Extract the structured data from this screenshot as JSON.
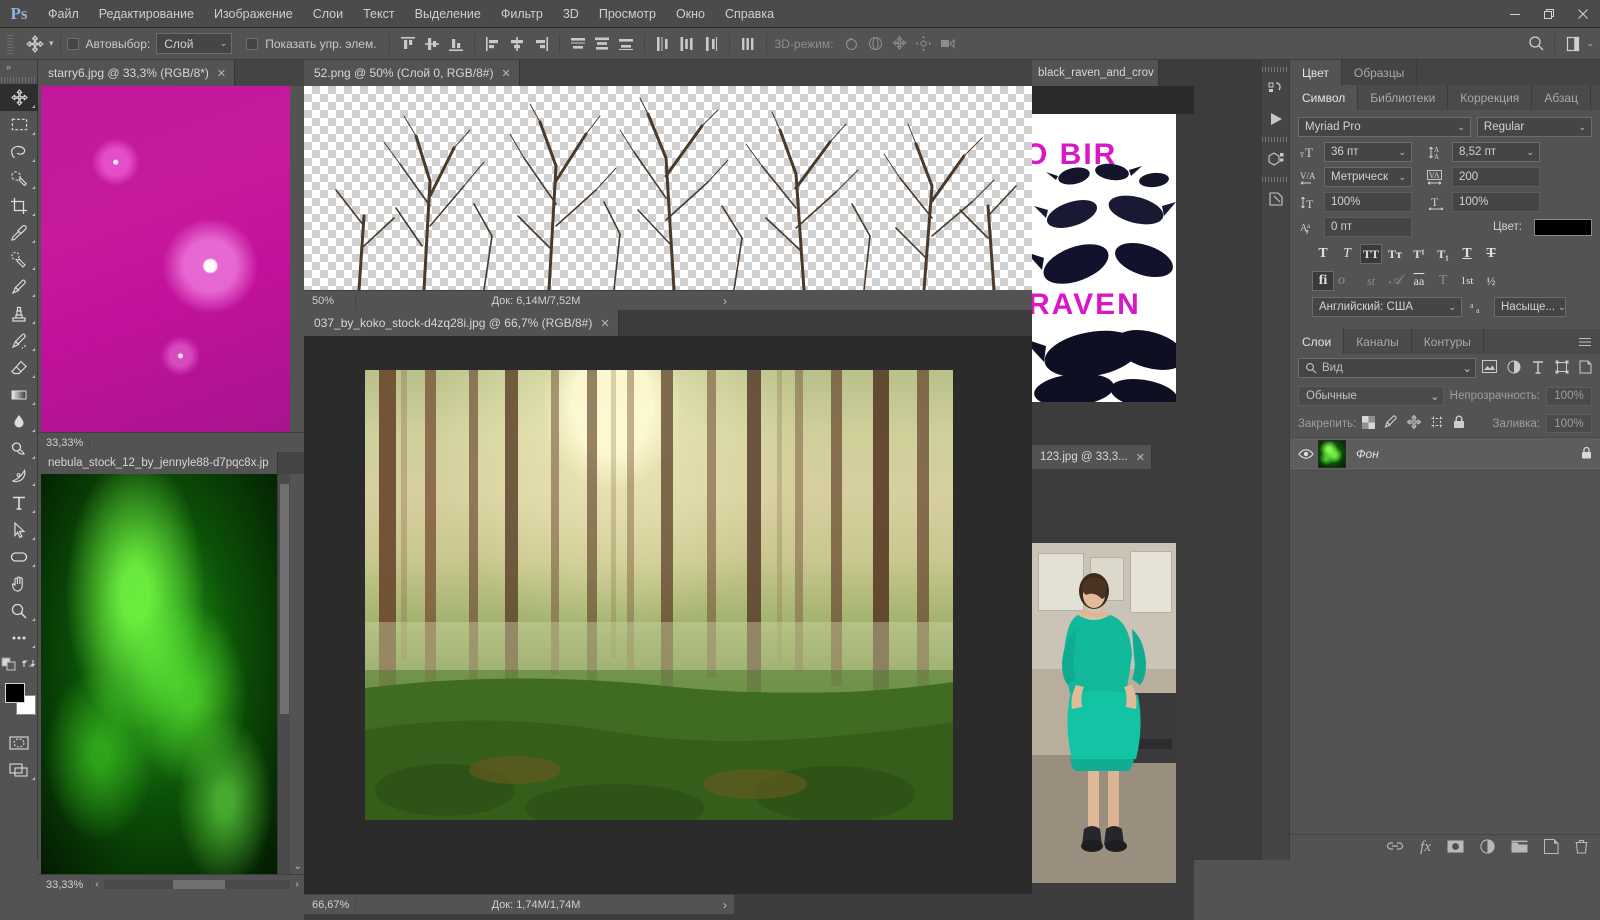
{
  "app": {
    "logo": "Ps"
  },
  "menubar": {
    "items": [
      "Файл",
      "Редактирование",
      "Изображение",
      "Слои",
      "Текст",
      "Выделение",
      "Фильтр",
      "3D",
      "Просмотр",
      "Окно",
      "Справка"
    ],
    "window_controls": [
      "minimize",
      "restore",
      "close"
    ]
  },
  "options_bar": {
    "tool": "move-tool",
    "autoselect_label": "Автовыбор:",
    "autoselect_checked": false,
    "autoselect_value": "Слой",
    "show_controls_label": "Показать упр. элем.",
    "show_controls_checked": false,
    "align_icons": [
      "align-top-edges",
      "align-vertical-centers",
      "align-bottom-edges",
      "align-left-edges",
      "align-horizontal-centers",
      "align-right-edges"
    ],
    "distribute_icons": [
      "distribute-top-edges",
      "distribute-vertical-centers",
      "distribute-bottom-edges",
      "distribute-left-edges",
      "distribute-horizontal-centers",
      "distribute-right-edges",
      "distribute-spacing"
    ],
    "mode3d_label": "3D-режим:",
    "mode3d_icons": [
      "orbit-3d",
      "roll-3d",
      "pan-3d",
      "slide-3d",
      "zoom-camera-3d"
    ],
    "search_icon": "search-icon",
    "workspace_icon": "workspace-switcher"
  },
  "toolbar": {
    "collapse_icon": "double-chevron-right",
    "tools": [
      {
        "name": "move-tool",
        "active": true
      },
      {
        "name": "rectangular-marquee-tool",
        "active": false
      },
      {
        "name": "lasso-tool",
        "active": false
      },
      {
        "name": "quick-selection-tool",
        "active": false
      },
      {
        "name": "crop-tool",
        "active": false
      },
      {
        "name": "eyedropper-tool",
        "active": false
      },
      {
        "name": "spot-healing-brush-tool",
        "active": false
      },
      {
        "name": "brush-tool",
        "active": false
      },
      {
        "name": "clone-stamp-tool",
        "active": false
      },
      {
        "name": "history-brush-tool",
        "active": false
      },
      {
        "name": "eraser-tool",
        "active": false
      },
      {
        "name": "gradient-tool",
        "active": false
      },
      {
        "name": "blur-tool",
        "active": false
      },
      {
        "name": "dodge-tool",
        "active": false
      },
      {
        "name": "pen-tool",
        "active": false
      },
      {
        "name": "horizontal-type-tool",
        "active": false
      },
      {
        "name": "path-selection-tool",
        "active": false
      },
      {
        "name": "rounded-rectangle-tool",
        "active": false
      },
      {
        "name": "hand-tool",
        "active": false
      },
      {
        "name": "zoom-tool",
        "active": false
      },
      {
        "name": "edit-toolbar-tool",
        "active": false
      }
    ],
    "default_colors_icon": "default-colors",
    "swap_colors_icon": "swap-colors",
    "foreground_color": "#000000",
    "background_color": "#ffffff",
    "quickmask_icon": "quick-mask-mode",
    "screenmode_icon": "screen-mode"
  },
  "documents": [
    {
      "id": "starry",
      "tab_title": "starry6.jpg @ 33,3% (RGB/8*)",
      "active": true,
      "zoom": "33,33%",
      "doc_info": "",
      "thumb_kind": "magenta-nebula"
    },
    {
      "id": "png52",
      "tab_title": "52.png @ 50% (Слой 0, RGB/8#)",
      "active": true,
      "zoom": "50%",
      "doc_info": "Док: 6,14M/7,52M",
      "thumb_kind": "trees-transparent"
    },
    {
      "id": "nebula",
      "tab_title": "nebula_stock_12_by_jennyle88-d7pqc8x.jp",
      "active": true,
      "zoom": "33,33%",
      "doc_info": "",
      "thumb_kind": "green-nebula"
    },
    {
      "id": "forest",
      "tab_title": "037_by_koko_stock-d4zq28i.jpg @ 66,7% (RGB/8#)",
      "active": true,
      "zoom": "66,67%",
      "doc_info": "Док: 1,74M/1,74M",
      "thumb_kind": "forest"
    },
    {
      "id": "raven",
      "tab_title": "black_raven_and_crov",
      "active": true,
      "zoom": "",
      "doc_info": "",
      "thumb_kind": "raven-poster"
    },
    {
      "id": "girl",
      "tab_title": "123.jpg @ 33,3...",
      "active": true,
      "zoom": "",
      "doc_info": "",
      "thumb_kind": "girl-photo"
    }
  ],
  "right_dock": {
    "rail_icons": [
      "history-icon",
      "play-icon",
      "3d-icon",
      "properties-icon"
    ],
    "color_group": {
      "tabs": [
        {
          "label": "Цвет",
          "active": true
        },
        {
          "label": "Образцы",
          "active": false
        }
      ]
    },
    "character_group": {
      "tabs": [
        {
          "label": "Символ",
          "active": true
        },
        {
          "label": "Библиотеки",
          "active": false
        },
        {
          "label": "Коррекция",
          "active": false
        },
        {
          "label": "Абзац",
          "active": false
        }
      ],
      "font_family": "Myriad Pro",
      "font_style": "Regular",
      "font_size_icon": "font-size-icon",
      "font_size": "36 пт",
      "leading_icon": "leading-icon",
      "leading": "8,52 пт",
      "kerning_icon": "kerning-icon",
      "kerning": "Метрическ",
      "tracking_icon": "tracking-icon",
      "tracking": "200",
      "vscale_icon": "vertical-scale-icon",
      "vertical_scale": "100%",
      "hscale_icon": "horizontal-scale-icon",
      "horizontal_scale": "100%",
      "baseline_icon": "baseline-shift-icon",
      "baseline_shift": "0 пт",
      "color_label": "Цвет:",
      "color_value": "#000000",
      "style_row1": [
        {
          "glyph": "T",
          "name": "faux-bold",
          "on": false,
          "dim": false
        },
        {
          "glyph": "T",
          "name": "faux-italic",
          "on": false,
          "dim": false
        },
        {
          "glyph": "TT",
          "name": "all-caps",
          "on": true,
          "dim": false
        },
        {
          "glyph": "Tт",
          "name": "small-caps",
          "on": false,
          "dim": false
        },
        {
          "glyph": "T¹",
          "name": "superscript",
          "on": false,
          "dim": false
        },
        {
          "glyph": "T₁",
          "name": "subscript",
          "on": false,
          "dim": false
        },
        {
          "glyph": "T",
          "name": "underline",
          "on": false,
          "dim": false
        },
        {
          "glyph": "T",
          "name": "strikethrough",
          "on": false,
          "dim": false
        }
      ],
      "style_row2": [
        {
          "glyph": "fi",
          "name": "standard-ligatures",
          "on": true,
          "dim": false
        },
        {
          "glyph": "o⃒",
          "name": "contextual-alternates",
          "on": false,
          "dim": true
        },
        {
          "glyph": "st",
          "name": "discretionary-ligatures",
          "on": false,
          "dim": true
        },
        {
          "glyph": "𝒜",
          "name": "swash",
          "on": false,
          "dim": true
        },
        {
          "glyph": "aa",
          "name": "oldstyle",
          "on": false,
          "dim": false
        },
        {
          "glyph": "T",
          "name": "titling-alternates",
          "on": false,
          "dim": true
        },
        {
          "glyph": "1st",
          "name": "ordinals",
          "on": false,
          "dim": false
        },
        {
          "glyph": "½",
          "name": "fractions",
          "on": false,
          "dim": false
        }
      ],
      "language": "Английский: США",
      "antialias_icon": "anti-alias-icon",
      "antialias": "Насыще..."
    },
    "layers_group": {
      "tabs": [
        {
          "label": "Слои",
          "active": true
        },
        {
          "label": "Каналы",
          "active": false
        },
        {
          "label": "Контуры",
          "active": false
        }
      ],
      "filter_placeholder": "Вид",
      "filter_icons": [
        "filter-pixel-icon",
        "filter-adjustment-icon",
        "filter-type-icon",
        "filter-shape-icon",
        "filter-smart-icon"
      ],
      "blend_mode": "Обычные",
      "opacity_label": "Непрозрачность:",
      "opacity_value": "100%",
      "lock_label": "Закрепить:",
      "lock_icons": [
        "lock-transparent-icon",
        "lock-image-icon",
        "lock-position-icon",
        "lock-artboard-icon",
        "lock-all-icon"
      ],
      "fill_label": "Заливка:",
      "fill_value": "100%",
      "layers": [
        {
          "name": "Фон",
          "visible": true,
          "locked": true,
          "thumb_kind": "green-nebula"
        }
      ],
      "bottom_icons": [
        "link-layers-icon",
        "layer-styles-icon",
        "layer-mask-icon",
        "adjustment-layer-icon",
        "new-group-icon",
        "new-layer-icon",
        "delete-layer-icon"
      ]
    }
  }
}
